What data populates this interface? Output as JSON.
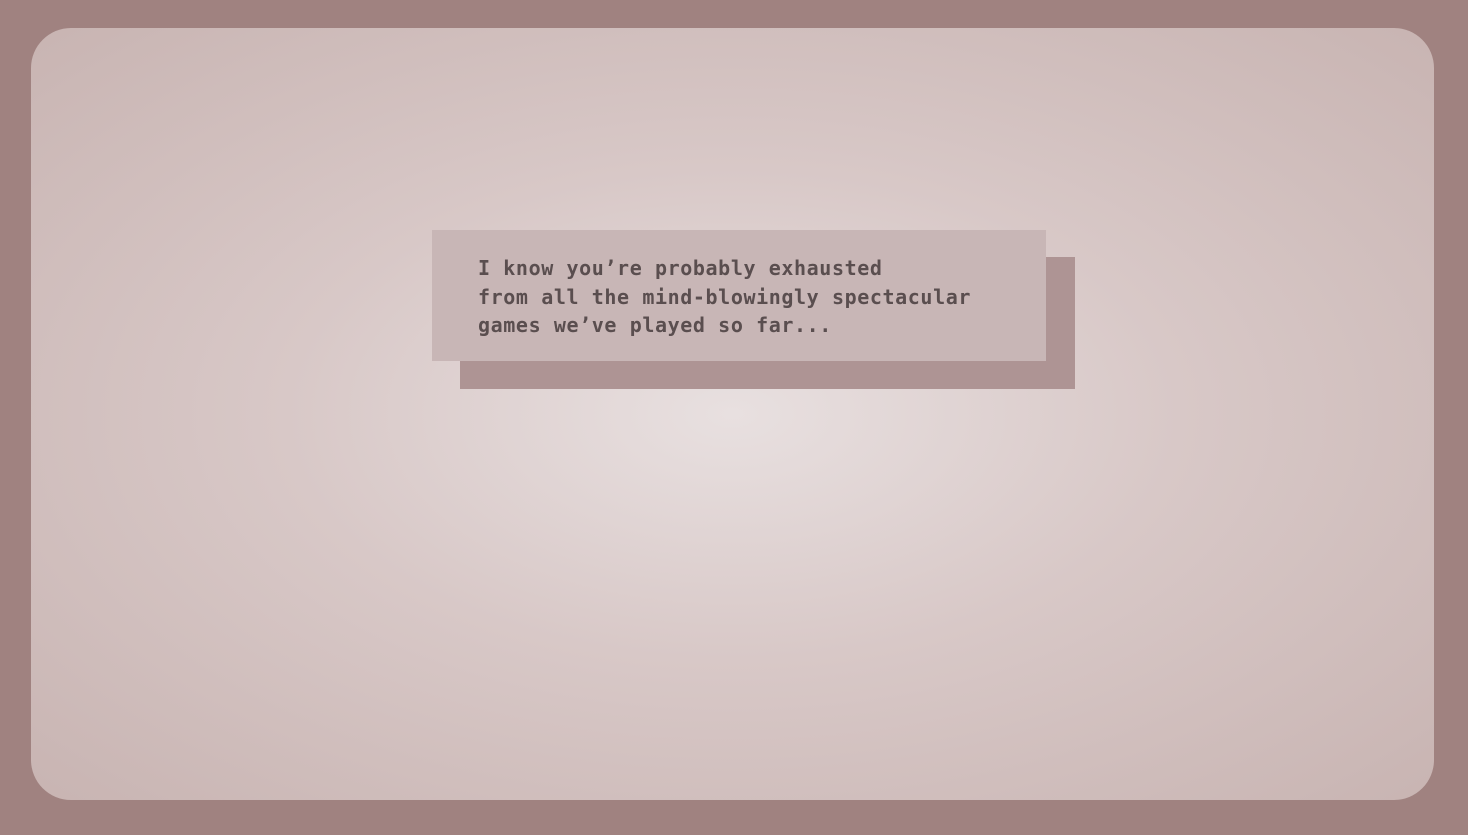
{
  "dialog": {
    "lines": [
      "I know you’re probably exhausted",
      "from all the mind-blowingly spectacular",
      "games we’ve played so far..."
    ]
  },
  "colors": {
    "bezel": "#a08280",
    "screen_center": "#e8e0e0",
    "screen_edge": "#c8b4b2",
    "dialog_bg": "#c8b6b6",
    "dialog_shadow": "#ae9494",
    "dialog_text": "#5a4e4f"
  }
}
